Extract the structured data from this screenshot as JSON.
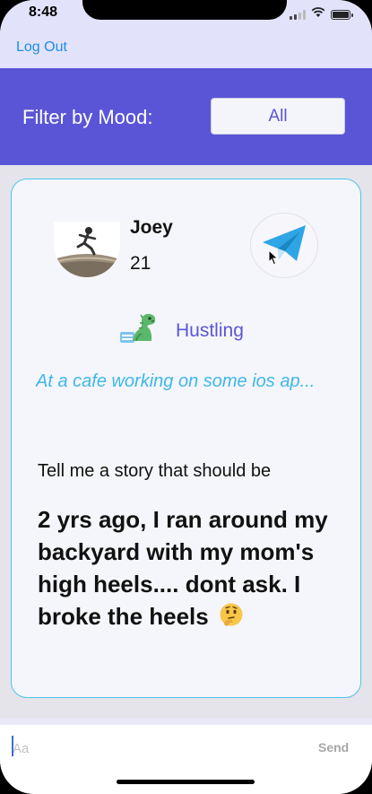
{
  "status_bar": {
    "time": "8:48"
  },
  "nav": {
    "logout_label": "Log Out"
  },
  "filter": {
    "label": "Filter by Mood:",
    "selected": "All"
  },
  "card": {
    "user_name": "Joey",
    "user_age": "21",
    "mood_label": "Hustling",
    "status_text": "At a cafe working on some ios ap...",
    "prompt": "Tell me a story that should be",
    "story": "2 yrs ago, I ran around my backyard with my mom's high heels.... dont ask. I broke the heels"
  },
  "composer": {
    "placeholder": "Aa",
    "send_label": "Send"
  },
  "colors": {
    "accent": "#5a55d6",
    "link": "#1a8fe3",
    "status_text": "#3fb6ea",
    "card_border": "#4fc3f0",
    "telegram": "#2ea6e6"
  },
  "icons": [
    "wifi-icon",
    "battery-icon",
    "telegram-send-icon",
    "dinosaur-mood-icon",
    "thinking-face-emoji",
    "mouse-cursor-icon"
  ]
}
